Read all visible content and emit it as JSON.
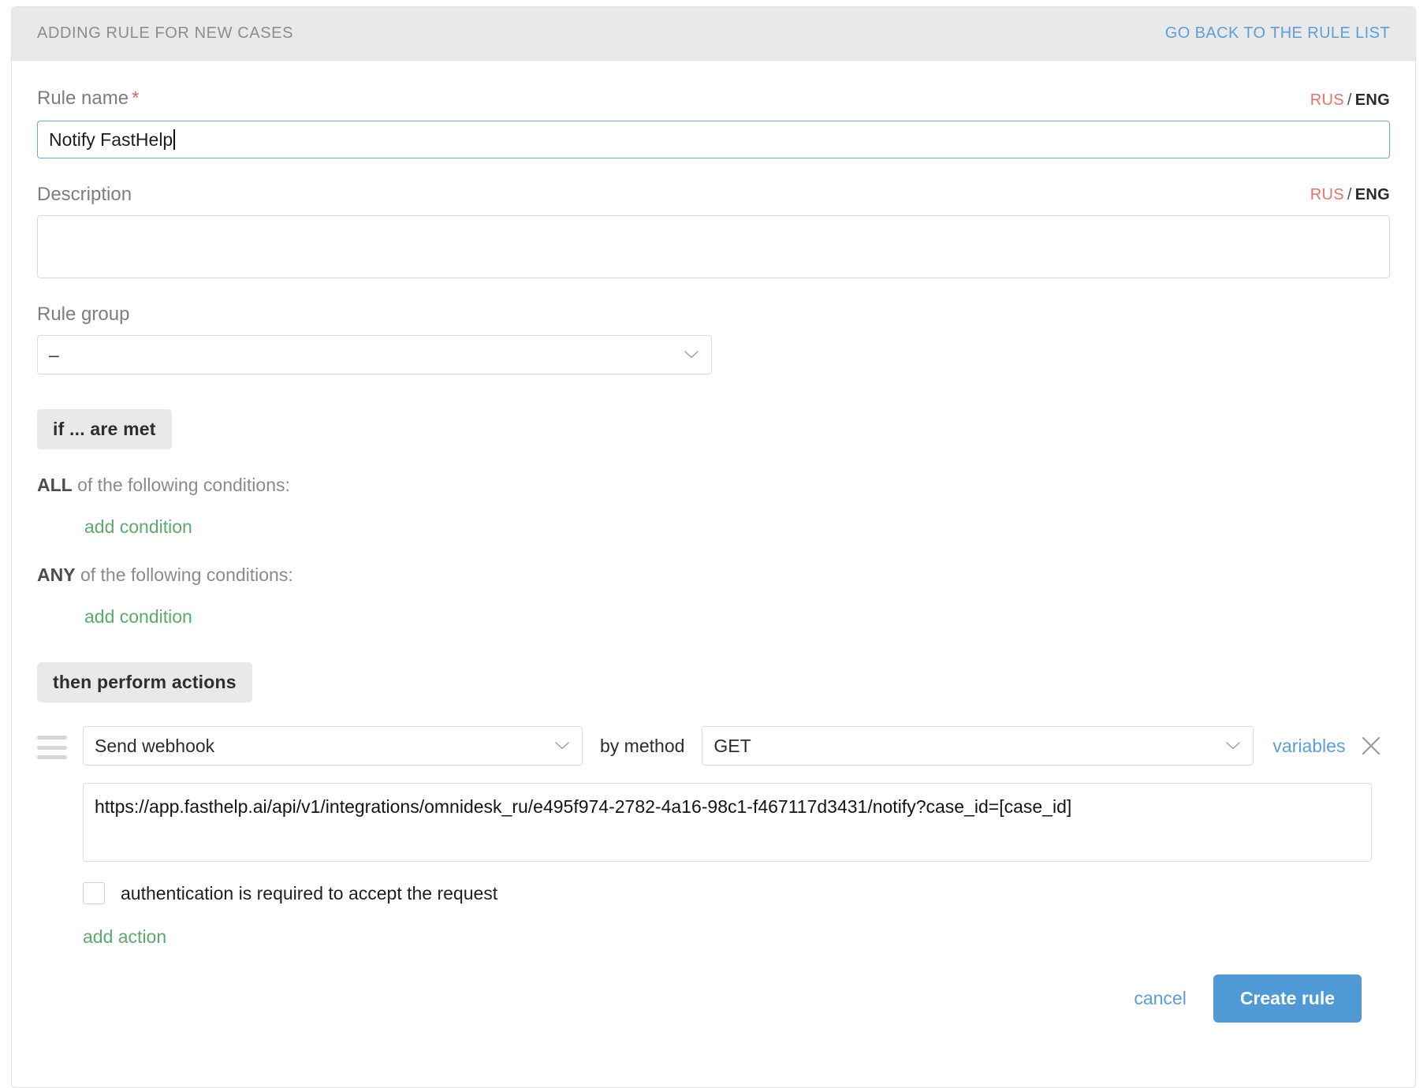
{
  "header": {
    "title": "ADDING RULE FOR NEW CASES",
    "back_link": "GO BACK TO THE RULE LIST"
  },
  "rule_name": {
    "label": "Rule name",
    "required_mark": "*",
    "value": "Notify FastHelp",
    "placeholder": ""
  },
  "description": {
    "label": "Description",
    "value": "",
    "placeholder": ""
  },
  "lang_toggle": {
    "rus": "RUS",
    "separator": "/",
    "eng": "ENG"
  },
  "rule_group": {
    "label": "Rule group",
    "value": "–",
    "options": [
      "–"
    ]
  },
  "conditions": {
    "badge": "if ... are met",
    "all": {
      "prefix": "ALL",
      "suffix": " of the following conditions:",
      "add_link": "add condition"
    },
    "any": {
      "prefix": "ANY",
      "suffix": " of the following conditions:",
      "add_link": "add condition"
    }
  },
  "actions": {
    "badge": "then perform actions",
    "action_type": "Send webhook",
    "by_method_label": "by method",
    "method": "GET",
    "variables_link": "variables",
    "url_value": "https://app.fasthelp.ai/api/v1/integrations/omnidesk_ru/e495f974-2782-4a16-98c1-f467117d3431/notify?case_id=[case_id]",
    "auth_checkbox_label": "authentication is required to accept the request",
    "auth_checked": false,
    "add_action_link": "add action"
  },
  "footer": {
    "cancel": "cancel",
    "submit": "Create rule"
  },
  "colors": {
    "accent_blue": "#4f9ad6",
    "link_blue": "#5a9fd8",
    "green_link": "#5aab6b",
    "required_red": "#e06666",
    "rus_red": "#e8736b",
    "header_bg": "#e9e9e9"
  }
}
